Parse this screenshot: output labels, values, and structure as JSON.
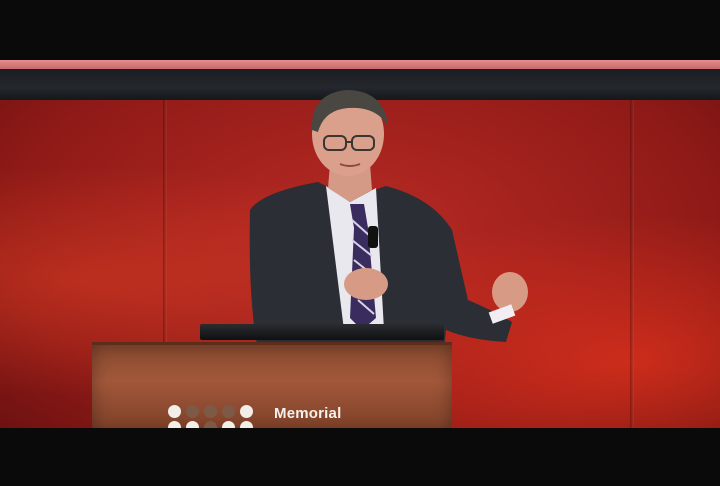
{
  "podium": {
    "logo_text": "Memorial"
  },
  "colors": {
    "backdrop": "#b82a24",
    "podium_wood": "#a2583a",
    "suit": "#2b2f35",
    "tie": "#3a2c5e"
  }
}
